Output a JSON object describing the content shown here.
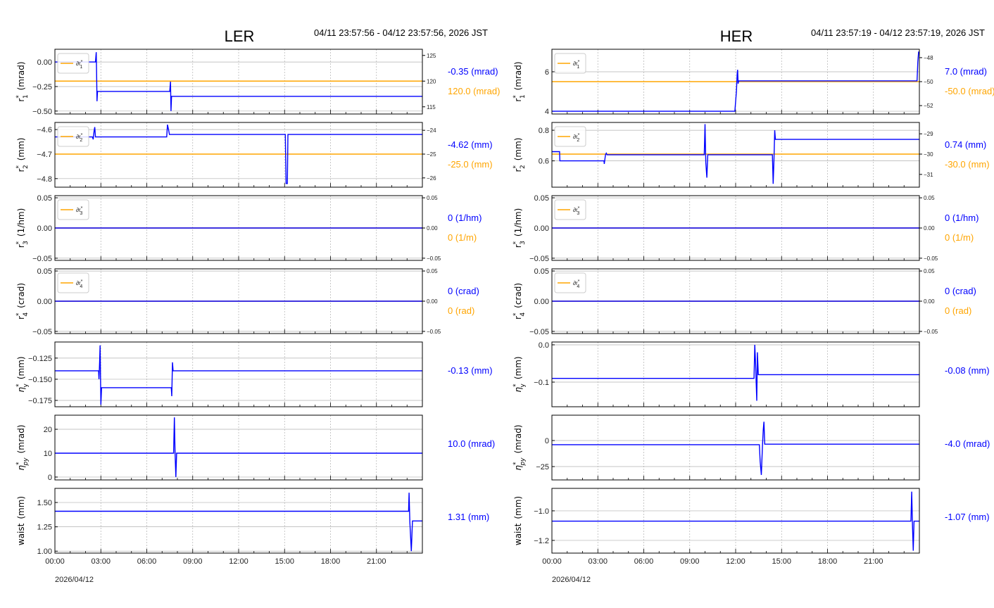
{
  "colors": {
    "measured": "#0000ff",
    "target": "#ffa500",
    "grid": "#b0b0b0"
  },
  "chart_data": [
    {
      "type": "line",
      "title": "LER",
      "time_range": "04/11 23:57:56 - 04/12 23:57:56, 2026 JST",
      "date_label": "2026/04/12",
      "x_unit": "hours",
      "xlim": [
        0,
        24
      ],
      "x_ticks": [
        "00:00",
        "03:00",
        "06:00",
        "09:00",
        "12:00",
        "15:00",
        "18:00",
        "21:00"
      ],
      "panels": [
        {
          "ylabel": {
            "sym": "r",
            "sup": "*",
            "sub": "1",
            "unit": "(mrad)"
          },
          "ylim": [
            -0.53,
            0.13
          ],
          "yticks": [
            0.0,
            -0.25,
            -0.5
          ],
          "ytick_labels": [
            "0.00",
            "−0.25",
            "−0.50"
          ],
          "legend": "∂r*1",
          "y2lim": [
            113.6,
            126.2
          ],
          "y2ticks": [
            125,
            120,
            115
          ],
          "y2tick_labels": [
            "125",
            "120",
            "115"
          ],
          "series": [
            [
              0,
              0
            ],
            [
              2.65,
              0
            ],
            [
              2.7,
              0.1
            ],
            [
              2.72,
              -0.1
            ],
            [
              2.75,
              -0.4
            ],
            [
              2.78,
              -0.3
            ],
            [
              7.5,
              -0.3
            ],
            [
              7.55,
              -0.2
            ],
            [
              7.58,
              -0.5
            ],
            [
              7.62,
              -0.35
            ],
            [
              24,
              -0.35
            ]
          ],
          "target": 120,
          "value_label": "-0.35 (mrad)",
          "target_label": "120.0 (mrad)"
        },
        {
          "ylabel": {
            "sym": "r",
            "sup": "*",
            "sub": "2",
            "unit": "(mm)"
          },
          "ylim": [
            -4.835,
            -4.571
          ],
          "yticks": [
            -4.6,
            -4.7,
            -4.8
          ],
          "ytick_labels": [
            "−4.6",
            "−4.7",
            "−4.8"
          ],
          "legend": "∂r*2",
          "y2lim": [
            -26.39,
            -23.67
          ],
          "y2ticks": [
            -24,
            -25,
            -26
          ],
          "y2tick_labels": [
            "−24",
            "−25",
            "−26"
          ],
          "series": [
            [
              0,
              -4.63
            ],
            [
              2.45,
              -4.63
            ],
            [
              2.5,
              -4.64
            ],
            [
              2.55,
              -4.61
            ],
            [
              2.6,
              -4.59
            ],
            [
              2.65,
              -4.63
            ],
            [
              7.3,
              -4.63
            ],
            [
              7.35,
              -4.58
            ],
            [
              7.42,
              -4.6
            ],
            [
              7.48,
              -4.62
            ],
            [
              15.05,
              -4.62
            ],
            [
              15.1,
              -4.82
            ],
            [
              15.18,
              -4.82
            ],
            [
              15.22,
              -4.62
            ],
            [
              24,
              -4.62
            ]
          ],
          "target": -25,
          "value_label": "-4.62 (mm)",
          "target_label": "-25.0 (mm)"
        },
        {
          "ylabel": {
            "sym": "r",
            "sup": "*",
            "sub": "3",
            "unit": "(1/hm)"
          },
          "ylim": [
            -0.0536,
            0.0536
          ],
          "yticks": [
            0.05,
            0,
            -0.05
          ],
          "ytick_labels": [
            "0.05",
            "0.00",
            "−0.05"
          ],
          "legend": "∂r*3",
          "y2lim": [
            -0.0536,
            0.0536
          ],
          "y2ticks": [
            0.05,
            0,
            -0.05
          ],
          "y2tick_labels": [
            "0.05",
            "0.00",
            "−0.05"
          ],
          "series": [
            [
              0,
              0
            ],
            [
              24,
              0
            ]
          ],
          "target": 0,
          "value_label": "0 (1/hm)",
          "target_label": "0 (1/m)"
        },
        {
          "ylabel": {
            "sym": "r",
            "sup": "*",
            "sub": "4",
            "unit": "(crad)"
          },
          "ylim": [
            -0.0536,
            0.0536
          ],
          "yticks": [
            0.05,
            0,
            -0.05
          ],
          "ytick_labels": [
            "0.05",
            "0.00",
            "−0.05"
          ],
          "legend": "∂r*4",
          "y2lim": [
            -0.0536,
            0.0536
          ],
          "y2ticks": [
            0.05,
            0,
            -0.05
          ],
          "y2tick_labels": [
            "0.05",
            "0.00",
            "−0.05"
          ],
          "series": [
            [
              0,
              0
            ],
            [
              24,
              0
            ]
          ],
          "target": 0,
          "value_label": "0 (crad)",
          "target_label": "0 (rad)"
        },
        {
          "ylabel": {
            "sym": "η",
            "sup": "*",
            "sub": "y",
            "unit": "(mm)"
          },
          "ylim": [
            -0.1825,
            -0.106
          ],
          "yticks": [
            -0.125,
            -0.15,
            -0.175
          ],
          "ytick_labels": [
            "−0.125",
            "−0.150",
            "−0.175"
          ],
          "series": [
            [
              0,
              -0.14
            ],
            [
              2.85,
              -0.14
            ],
            [
              2.88,
              -0.15
            ],
            [
              2.92,
              -0.13
            ],
            [
              2.95,
              -0.11
            ],
            [
              3.0,
              -0.18
            ],
            [
              3.05,
              -0.16
            ],
            [
              7.6,
              -0.16
            ],
            [
              7.63,
              -0.17
            ],
            [
              7.68,
              -0.13
            ],
            [
              7.72,
              -0.14
            ],
            [
              24,
              -0.14
            ]
          ],
          "value_label": "-0.13 (mm)"
        },
        {
          "ylabel": {
            "sym": "η",
            "sup": "*",
            "sub": "py",
            "unit": "(mrad)"
          },
          "ylim": [
            -1.2,
            25.9
          ],
          "yticks": [
            20,
            10,
            0
          ],
          "ytick_labels": [
            "20",
            "10",
            "0"
          ],
          "series": [
            [
              0,
              10
            ],
            [
              7.75,
              10
            ],
            [
              7.8,
              25
            ],
            [
              7.85,
              10
            ],
            [
              7.9,
              0
            ],
            [
              7.95,
              10
            ],
            [
              24,
              10
            ]
          ],
          "value_label": "10.0 (mrad)"
        },
        {
          "ylabel": {
            "sym": "waist",
            "unit": "(mm)"
          },
          "ylim": [
            0.98,
            1.645
          ],
          "yticks": [
            1.5,
            1.25,
            1.0
          ],
          "ytick_labels": [
            "1.50",
            "1.25",
            "1.00"
          ],
          "series": [
            [
              0,
              1.41
            ],
            [
              23.1,
              1.41
            ],
            [
              23.13,
              1.6
            ],
            [
              23.18,
              1.3
            ],
            [
              23.28,
              1.0
            ],
            [
              23.35,
              1.31
            ],
            [
              24,
              1.31
            ]
          ],
          "value_label": "1.31 (mm)"
        }
      ]
    },
    {
      "type": "line",
      "title": "HER",
      "time_range": "04/11 23:57:19 - 04/12 23:57:19, 2026 JST",
      "date_label": "2026/04/12",
      "x_unit": "hours",
      "xlim": [
        0,
        24
      ],
      "x_ticks": [
        "00:00",
        "03:00",
        "06:00",
        "09:00",
        "12:00",
        "15:00",
        "18:00",
        "21:00"
      ],
      "panels": [
        {
          "ylabel": {
            "sym": "r",
            "sup": "*",
            "sub": "1",
            "unit": "(mrad)"
          },
          "ylim": [
            3.86,
            7.14
          ],
          "yticks": [
            6,
            4
          ],
          "ytick_labels": [
            "6",
            "4"
          ],
          "legend": "∂r*1",
          "y2lim": [
            -52.7,
            -47.3
          ],
          "y2ticks": [
            -48,
            -50,
            -52
          ],
          "y2tick_labels": [
            "−48",
            "−50",
            "−52"
          ],
          "series": [
            [
              0,
              4.0
            ],
            [
              11.95,
              4.0
            ],
            [
              12.05,
              5.0
            ],
            [
              12.1,
              5.9
            ],
            [
              12.13,
              6.1
            ],
            [
              12.16,
              5.4
            ],
            [
              12.2,
              5.54
            ],
            [
              23.85,
              5.54
            ],
            [
              23.9,
              6.5
            ],
            [
              23.95,
              7.0
            ],
            [
              24,
              7.0
            ]
          ],
          "target": -50,
          "value_label": "7.0 (mrad)",
          "target_label": "-50.0 (mrad)"
        },
        {
          "ylabel": {
            "sym": "r",
            "sup": "*",
            "sub": "2",
            "unit": "(mm)"
          },
          "ylim": [
            0.428,
            0.851
          ],
          "yticks": [
            0.8,
            0.6
          ],
          "ytick_labels": [
            "0.8",
            "0.6"
          ],
          "legend": "∂r*2",
          "y2lim": [
            -31.63,
            -28.44
          ],
          "y2ticks": [
            -29,
            -30,
            -31
          ],
          "y2tick_labels": [
            "−29",
            "−30",
            "−31"
          ],
          "series": [
            [
              0,
              0.66
            ],
            [
              0.5,
              0.66
            ],
            [
              0.52,
              0.6
            ],
            [
              3.4,
              0.6
            ],
            [
              3.42,
              0.58
            ],
            [
              3.5,
              0.64
            ],
            [
              3.55,
              0.65
            ],
            [
              3.6,
              0.64
            ],
            [
              9.95,
              0.64
            ],
            [
              10.0,
              0.84
            ],
            [
              10.05,
              0.59
            ],
            [
              10.12,
              0.49
            ],
            [
              10.18,
              0.64
            ],
            [
              14.4,
              0.64
            ],
            [
              14.45,
              0.45
            ],
            [
              14.5,
              0.6
            ],
            [
              14.55,
              0.8
            ],
            [
              14.6,
              0.74
            ],
            [
              24,
              0.74
            ]
          ],
          "target": -30,
          "value_label": "0.74 (mm)",
          "target_label": "-30.0 (mm)"
        },
        {
          "ylabel": {
            "sym": "r",
            "sup": "*",
            "sub": "3",
            "unit": "(1/hm)"
          },
          "ylim": [
            -0.0536,
            0.0536
          ],
          "yticks": [
            0.05,
            0,
            -0.05
          ],
          "ytick_labels": [
            "0.05",
            "0.00",
            "−0.05"
          ],
          "legend": "∂r*3",
          "y2lim": [
            -0.0536,
            0.0536
          ],
          "y2ticks": [
            0.05,
            0,
            -0.05
          ],
          "y2tick_labels": [
            "0.05",
            "0.00",
            "−0.05"
          ],
          "series": [
            [
              0,
              0
            ],
            [
              24,
              0
            ]
          ],
          "target": 0,
          "value_label": "0 (1/hm)",
          "target_label": "0 (1/m)"
        },
        {
          "ylabel": {
            "sym": "r",
            "sup": "*",
            "sub": "4",
            "unit": "(crad)"
          },
          "ylim": [
            -0.0536,
            0.0536
          ],
          "yticks": [
            0.05,
            0,
            -0.05
          ],
          "ytick_labels": [
            "0.05",
            "0.00",
            "−0.05"
          ],
          "legend": "∂r*4",
          "y2lim": [
            -0.0536,
            0.0536
          ],
          "y2ticks": [
            0.05,
            0,
            -0.05
          ],
          "y2tick_labels": [
            "0.05",
            "0.00",
            "−0.05"
          ],
          "series": [
            [
              0,
              0
            ],
            [
              24,
              0
            ]
          ],
          "target": 0,
          "value_label": "0 (crad)",
          "target_label": "0 (rad)"
        },
        {
          "ylabel": {
            "sym": "η",
            "sup": "*",
            "sub": "y",
            "unit": "(mm)"
          },
          "ylim": [
            -0.166,
            0.0075
          ],
          "yticks": [
            0.0,
            -0.1
          ],
          "ytick_labels": [
            "0.0",
            "−0.1"
          ],
          "series": [
            [
              0,
              -0.09
            ],
            [
              13.2,
              -0.09
            ],
            [
              13.25,
              0.0
            ],
            [
              13.3,
              -0.05
            ],
            [
              13.38,
              -0.15
            ],
            [
              13.42,
              -0.02
            ],
            [
              13.48,
              -0.08
            ],
            [
              24,
              -0.08
            ]
          ],
          "value_label": "-0.08 (mm)"
        },
        {
          "ylabel": {
            "sym": "η",
            "sup": "*",
            "sub": "py",
            "unit": "(mrad)"
          },
          "ylim": [
            -37.8,
            24.3
          ],
          "yticks": [
            0,
            -25
          ],
          "ytick_labels": [
            "0",
            "−25"
          ],
          "series": [
            [
              0,
              -4
            ],
            [
              13.55,
              -4
            ],
            [
              13.6,
              -20
            ],
            [
              13.68,
              -33
            ],
            [
              13.75,
              -5
            ],
            [
              13.8,
              10
            ],
            [
              13.85,
              18
            ],
            [
              13.9,
              -3.5
            ],
            [
              24,
              -3.5
            ]
          ],
          "value_label": "-4.0 (mrad)"
        },
        {
          "ylabel": {
            "sym": "waist",
            "unit": "(mm)"
          },
          "ylim": [
            -1.286,
            -0.848
          ],
          "yticks": [
            -1.0,
            -1.2
          ],
          "ytick_labels": [
            "−1.0",
            "−1.2"
          ],
          "series": [
            [
              0,
              -1.07
            ],
            [
              23.45,
              -1.07
            ],
            [
              23.5,
              -0.87
            ],
            [
              23.55,
              -1.1
            ],
            [
              23.6,
              -1.27
            ],
            [
              23.65,
              -1.07
            ],
            [
              24,
              -1.07
            ]
          ],
          "value_label": "-1.07 (mm)"
        }
      ]
    }
  ]
}
